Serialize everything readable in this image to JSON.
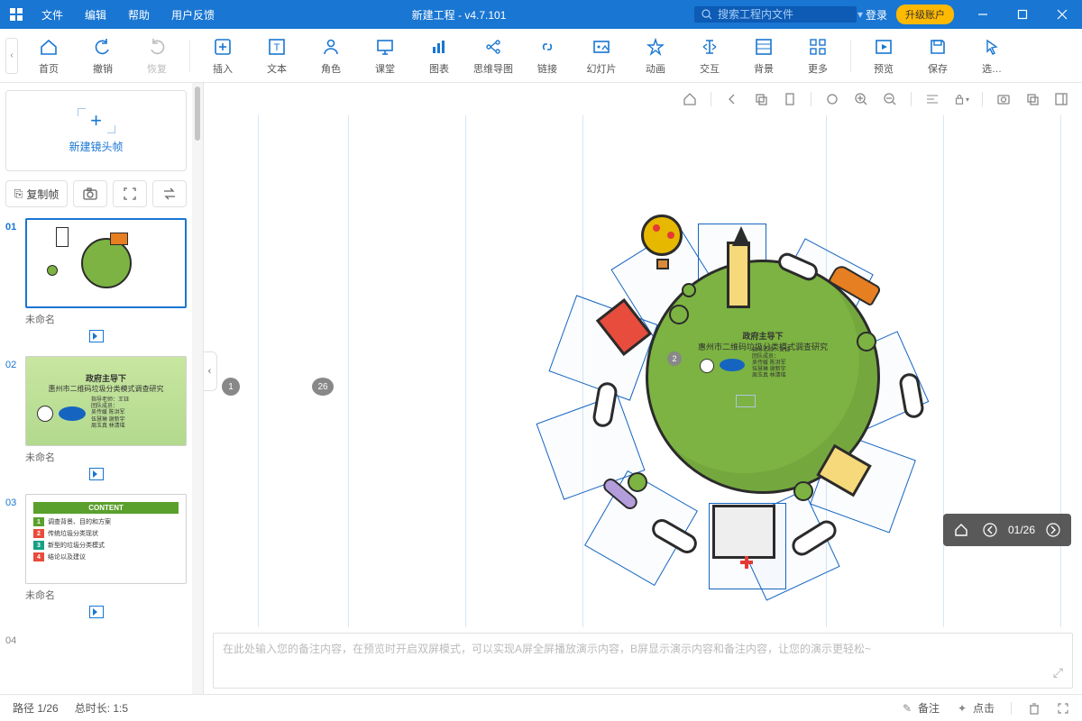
{
  "window": {
    "title": "新建工程 - v4.7.101"
  },
  "menu": {
    "file": "文件",
    "edit": "编辑",
    "help": "帮助",
    "feedback": "用户反馈"
  },
  "search": {
    "placeholder": "搜索工程内文件"
  },
  "account": {
    "login": "登录",
    "upgrade": "升级账户"
  },
  "toolbar": {
    "home": "首页",
    "undo": "撤销",
    "redo": "恢复",
    "insert": "插入",
    "text": "文本",
    "role": "角色",
    "classroom": "课堂",
    "chart": "图表",
    "mindmap": "思维导图",
    "link": "链接",
    "slide": "幻灯片",
    "animation": "动画",
    "interact": "交互",
    "background": "背景",
    "more": "更多",
    "preview": "预览",
    "save": "保存",
    "select": "选…"
  },
  "sidebar": {
    "newFrame": "新建镜头帧",
    "copyFrame": "复制帧",
    "slides": [
      {
        "num": "01",
        "title": "未命名"
      },
      {
        "num": "02",
        "title": "未命名"
      },
      {
        "num": "03",
        "title": "未命名"
      },
      {
        "num": "04",
        "title": ""
      }
    ]
  },
  "canvas": {
    "marker1": "1",
    "marker26": "26",
    "markerZ": "2",
    "slide2": {
      "line1": "政府主导下",
      "line2": "惠州市二维码垃圾分类模式调查研究",
      "rtext": "指导老师：王钰\n团队成员：\n吴传媛  陈洪军\n伍慧琳  谢新宇\n周玉真  林清瑶"
    },
    "slide3": {
      "title": "CONTENT",
      "items": [
        "调查背景、目的和方案",
        "传统垃圾分类现状",
        "新型的垃圾分类模式",
        "结论以及建议"
      ],
      "colors": [
        "#5aa02c",
        "#e74c3c",
        "#16a085",
        "#e74c3c"
      ]
    }
  },
  "floatNav": {
    "counter": "01/26"
  },
  "notes": {
    "placeholder": "在此处输入您的备注内容，在预览时开启双屏模式，可以实现A屏全屏播放演示内容，B屏显示演示内容和备注内容，让您的演示更轻松~"
  },
  "status": {
    "path": "路径 1/26",
    "duration": "总时长: 1:5",
    "remark": "备注",
    "click": "点击"
  }
}
